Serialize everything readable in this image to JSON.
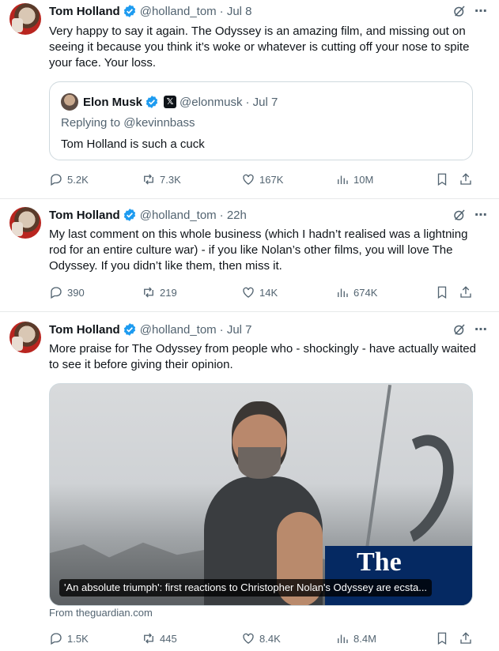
{
  "colors": {
    "verified": "#1d9bf0",
    "text": "#0f1419",
    "secondary": "#536471",
    "border": "#cfd9de",
    "guardian_blue": "#052962"
  },
  "icons": {
    "more": "⋯",
    "x_badge": "𝕏"
  },
  "tweets": [
    {
      "author": "Tom Holland",
      "handle": "@holland_tom",
      "time": "· Jul 8",
      "text": "Very happy to say it again. The Odyssey is an amazing film, and missing out on seeing it because you think it’s woke or whatever is cutting off your nose to spite your face. Your loss.",
      "quote": {
        "author": "Elon Musk",
        "handle": "@elonmusk",
        "time": "· Jul 7",
        "replying_to": "Replying to @kevinnbass",
        "text": "Tom Holland is such a cuck"
      },
      "stats": {
        "replies": "5.2K",
        "retweets": "7.3K",
        "likes": "167K",
        "views": "10M"
      }
    },
    {
      "author": "Tom Holland",
      "handle": "@holland_tom",
      "time": "· 22h",
      "text": "My last comment on this whole business (which I hadn’t realised was a lightning rod for an entire culture war) - if you like Nolan’s other films, you will love The Odyssey. If you didn’t like them, then miss it.",
      "stats": {
        "replies": "390",
        "retweets": "219",
        "likes": "14K",
        "views": "674K"
      }
    },
    {
      "author": "Tom Holland",
      "handle": "@holland_tom",
      "time": "· Jul 7",
      "text": "More praise for The Odyssey from people who - shockingly - have actually waited to see it before giving their opinion.",
      "card": {
        "brand": "The Guardian",
        "brand_visible": "The",
        "caption": "'An absolute triumph': first reactions to Christopher Nolan's Odyssey are ecsta...",
        "source": "From theguardian.com"
      },
      "stats": {
        "replies": "1.5K",
        "retweets": "445",
        "likes": "8.4K",
        "views": "8.4M"
      }
    }
  ]
}
